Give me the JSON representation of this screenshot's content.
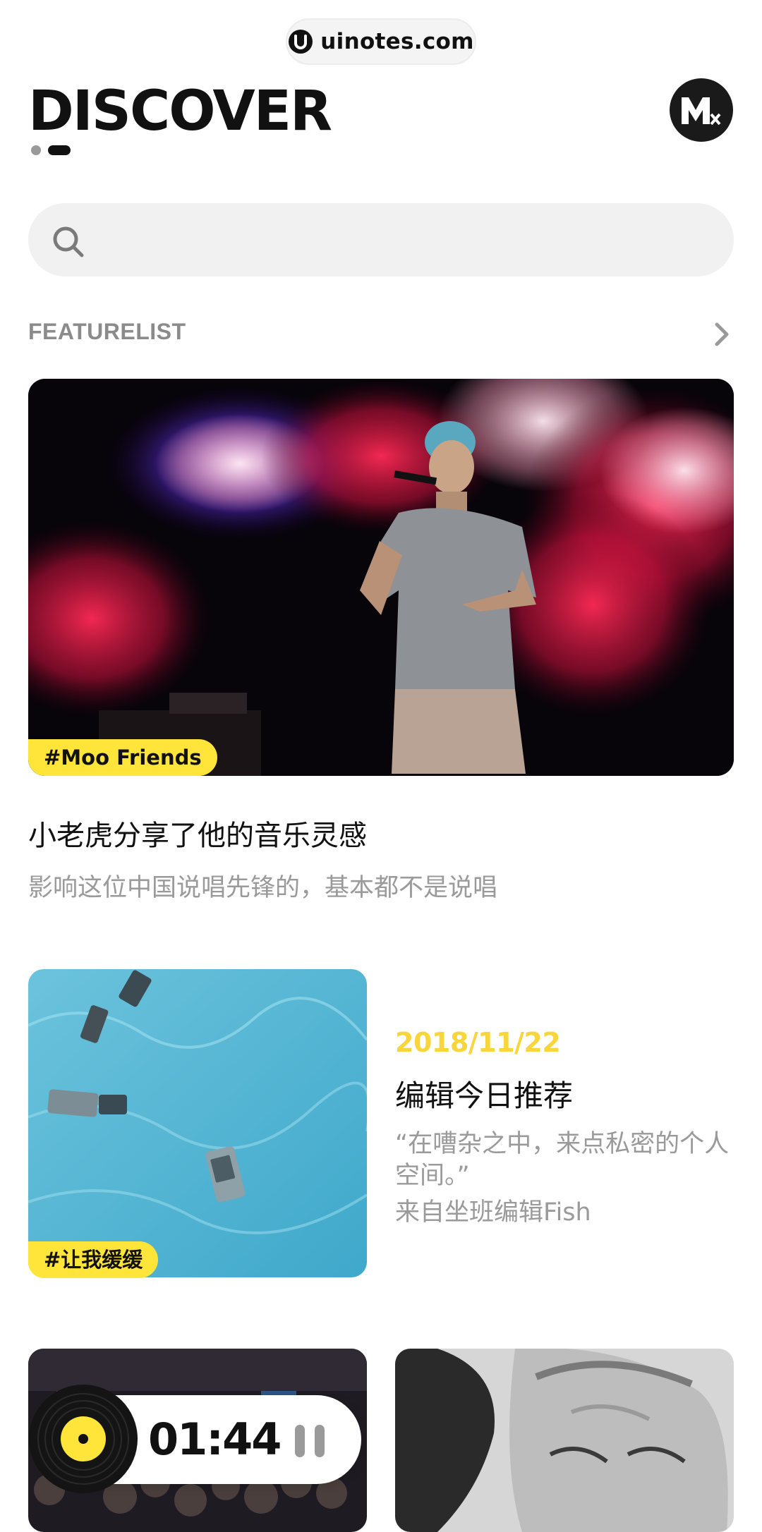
{
  "watermark": {
    "text": "uinotes.com"
  },
  "header": {
    "title": "DISCOVER",
    "avatar_icon": "m-logo-icon"
  },
  "search": {
    "placeholder": "",
    "icon": "search-icon"
  },
  "featurelist": {
    "label": "FEATURELIST",
    "more_icon": "chevron-right-icon"
  },
  "feature_card": {
    "tag": "#Moo Friends",
    "title": "小老虎分享了他的音乐灵感",
    "subtitle": "影响这位中国说唱先锋的，基本都不是说唱"
  },
  "editor_card": {
    "tag": "#让我缓缓",
    "date": "2018/11/22",
    "title": "编辑今日推荐",
    "quote": "“在嘈杂之中，来点私密的个人空间。”",
    "author": "来自坐班编辑Fish"
  },
  "player": {
    "time": "01:44",
    "state": "playing"
  },
  "colors": {
    "accent": "#ffe43a",
    "date": "#f8d53b",
    "muted": "#9a9a9a",
    "dark": "#111111"
  }
}
